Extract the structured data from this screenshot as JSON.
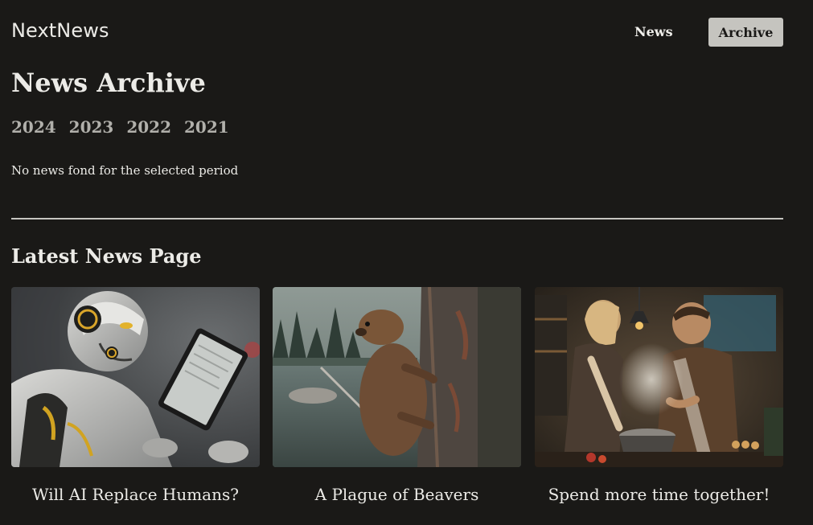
{
  "header": {
    "brand": "NextNews",
    "nav": {
      "news": "News",
      "archive": "Archive"
    }
  },
  "archive": {
    "title": "News Archive",
    "years": [
      "2024",
      "2023",
      "2022",
      "2021"
    ],
    "empty_message": "No news fond for the selected period"
  },
  "latest": {
    "title": "Latest News Page",
    "items": [
      {
        "title": "Will AI Replace Humans?",
        "image": "robot-with-tablet"
      },
      {
        "title": "A Plague of Beavers",
        "image": "beaver-on-tree"
      },
      {
        "title": "Spend more time together!",
        "image": "couple-cooking"
      }
    ]
  }
}
